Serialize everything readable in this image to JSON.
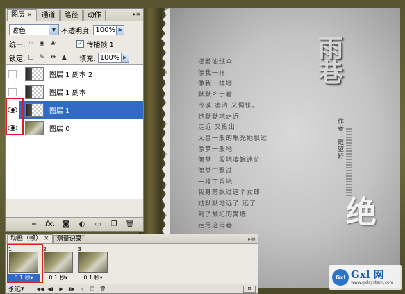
{
  "layers_panel": {
    "tabs": [
      {
        "label": "图层",
        "close": "×",
        "active": true
      },
      {
        "label": "通道",
        "active": false
      },
      {
        "label": "路径",
        "active": false
      },
      {
        "label": "动作",
        "active": false
      }
    ],
    "menu_icon": "▸≡",
    "blend_mode": "滤色",
    "opacity_label": "不透明度:",
    "opacity_value": "100%",
    "unify_label": "统一:",
    "propagate_label": "传播帧 1",
    "propagate_checked": "✓",
    "lock_label": "锁定:",
    "fill_label": "填充:",
    "fill_value": "100%",
    "layers": [
      {
        "name": "图层 1 副本 2",
        "visible": false,
        "selected": false,
        "thumb": "transparent"
      },
      {
        "name": "图层 1 副本",
        "visible": false,
        "selected": false,
        "thumb": "transparent"
      },
      {
        "name": "图层 1",
        "visible": true,
        "selected": true,
        "thumb": "transparent"
      },
      {
        "name": "图层 0",
        "visible": true,
        "selected": false,
        "thumb": "photo"
      }
    ],
    "bottom_icons": [
      "link-icon",
      "fx-icon",
      "mask-icon",
      "adjustment-icon",
      "group-icon",
      "new-layer-icon",
      "trash-icon"
    ],
    "fx_label": "fx."
  },
  "animation_panel": {
    "tabs": [
      {
        "label": "动画（帧）",
        "close": "×",
        "active": true
      },
      {
        "label": "测量记录",
        "active": false
      }
    ],
    "frames": [
      {
        "number": "1",
        "delay": "0.1 秒▾",
        "selected": true
      },
      {
        "number": "2",
        "delay": "0.1 秒▾",
        "selected": false
      },
      {
        "number": "3",
        "delay": "0.1 秒▾",
        "selected": false
      }
    ],
    "loop_value": "永远",
    "loop_arrow": "▾",
    "resize_label": "⊡"
  },
  "artwork": {
    "poem_lines": [
      "撑着油纸伞",
      "像我一样",
      "像我一样地",
      "默默彳亍着",
      "冷漠 凄清 又惆怅。",
      "她默默地走近",
      "走近 又投出",
      "太息一般的眼光她飘过",
      "像梦一般地",
      "像梦一般地凄婉迷茫",
      "像梦中飘过",
      "一枝丁香地",
      "我身旁飘过这个女郎",
      "她默默地远了 远了",
      "到了颓圮的篱墙",
      "走尽这雨巷"
    ],
    "title": "雨巷",
    "author": "作者：戴望舒",
    "brush_glyph": "绝",
    "watermark_logo": "Gxl",
    "watermark_name": "Gxl 网",
    "watermark_url": "www.gxlsystem.com"
  }
}
